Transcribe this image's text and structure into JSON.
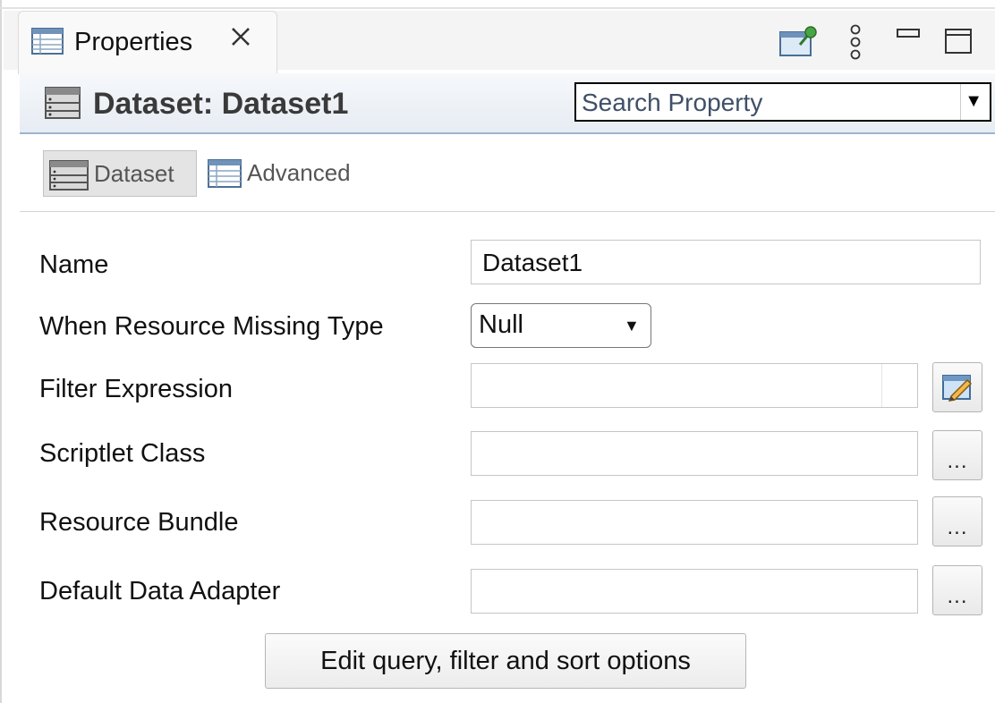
{
  "view_tab": {
    "label": "Properties",
    "icon": "properties-table-icon",
    "close_glyph": "✕"
  },
  "toolbar": {
    "icons": [
      "pin-editor-icon",
      "view-menu-icon",
      "minimize-icon",
      "maximize-icon"
    ]
  },
  "header": {
    "title": "Dataset: Dataset1",
    "icon": "dataset-icon",
    "search_placeholder": "Search Property"
  },
  "section_tabs": [
    {
      "label": "Dataset",
      "icon": "dataset-icon",
      "active": true
    },
    {
      "label": "Advanced",
      "icon": "table-icon",
      "active": false
    }
  ],
  "form": {
    "name": {
      "label": "Name",
      "value": "Dataset1"
    },
    "when_resource_missing": {
      "label": "When Resource Missing Type",
      "value": "Null"
    },
    "filter_expression": {
      "label": "Filter Expression",
      "value": ""
    },
    "scriptlet_class": {
      "label": "Scriptlet Class",
      "value": ""
    },
    "resource_bundle": {
      "label": "Resource Bundle",
      "value": ""
    },
    "default_data_adapter": {
      "label": "Default Data Adapter",
      "value": ""
    },
    "browse_label": "...",
    "edit_query_button": "Edit query, filter and sort options"
  }
}
